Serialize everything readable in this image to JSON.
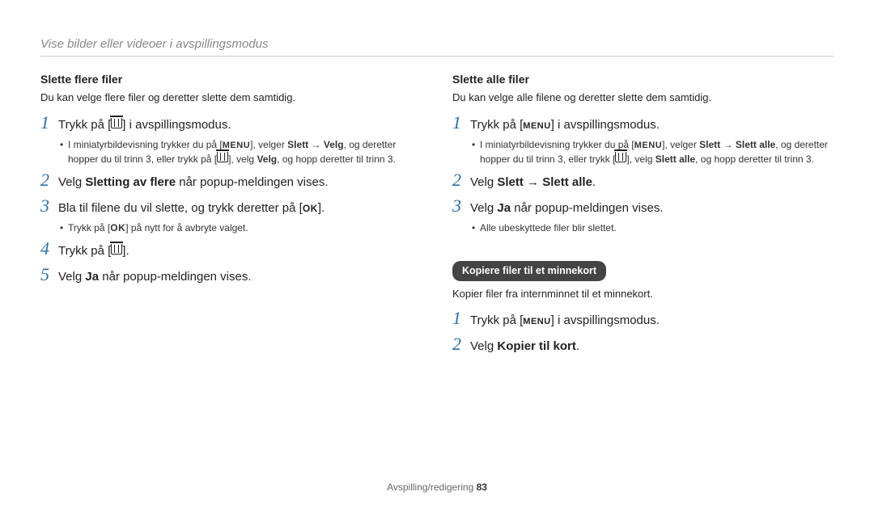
{
  "header": "Vise bilder eller videoer i avspillingsmodus",
  "left": {
    "subhead": "Slette flere filer",
    "intro": "Du kan velge flere filer og deretter slette dem samtidig.",
    "step1_a": "Trykk på [",
    "step1_b": "] i avspillingsmodus.",
    "bull1_a": "I miniatyrbildevisning trykker du på [",
    "bull1_b": "], velger ",
    "bull1_bold1": "Slett",
    "bull1_arrow": " → ",
    "bull1_bold2": "Velg",
    "bull1_c": ", og deretter hopper du til trinn 3, eller trykk på [",
    "bull1_d": "], velg ",
    "bull1_bold3": "Velg",
    "bull1_e": ", og hopp deretter til trinn 3.",
    "step2_a": "Velg ",
    "step2_bold": "Sletting av flere",
    "step2_b": " når popup-meldingen vises.",
    "step3_a": "Bla til filene du vil slette, og trykk deretter på [",
    "step3_b": "].",
    "bull3_a": "Trykk på [",
    "bull3_b": "] på nytt for å avbryte valget.",
    "step4_a": "Trykk på [",
    "step4_b": "].",
    "step5_a": "Velg ",
    "step5_bold": "Ja",
    "step5_b": " når popup-meldingen vises."
  },
  "right": {
    "subhead": "Slette alle filer",
    "intro": "Du kan velge alle filene og deretter slette dem samtidig.",
    "step1_a": "Trykk på [",
    "step1_b": "] i avspillingsmodus.",
    "bull1_a": "I miniatyrbildevisning trykker du på [",
    "bull1_b": "], velger ",
    "bull1_bold1": "Slett",
    "bull1_arrow": " → ",
    "bull1_bold2": "Slett alle",
    "bull1_c": ", og deretter hopper du til trinn 3, eller trykk [",
    "bull1_d": "], velg ",
    "bull1_bold3": "Slett alle",
    "bull1_e": ", og hopp deretter til trinn 3.",
    "step2_a": "Velg ",
    "step2_bold1": "Slett",
    "step2_arrow": " → ",
    "step2_bold2": "Slett alle",
    "step2_b": ".",
    "step3_a": "Velg ",
    "step3_bold": "Ja",
    "step3_b": " når popup-meldingen vises.",
    "bull3": "Alle ubeskyttede filer blir slettet.",
    "section2": "Kopiere filer til et minnekort",
    "intro2": "Kopier filer fra internminnet til et minnekort.",
    "s2_step1_a": "Trykk på [",
    "s2_step1_b": "] i avspillingsmodus.",
    "s2_step2_a": "Velg ",
    "s2_step2_bold": "Kopier til kort",
    "s2_step2_b": "."
  },
  "footer_a": "Avspilling/redigering  ",
  "footer_page": "83",
  "icons": {
    "menu": "MENU",
    "ok": "OK"
  }
}
